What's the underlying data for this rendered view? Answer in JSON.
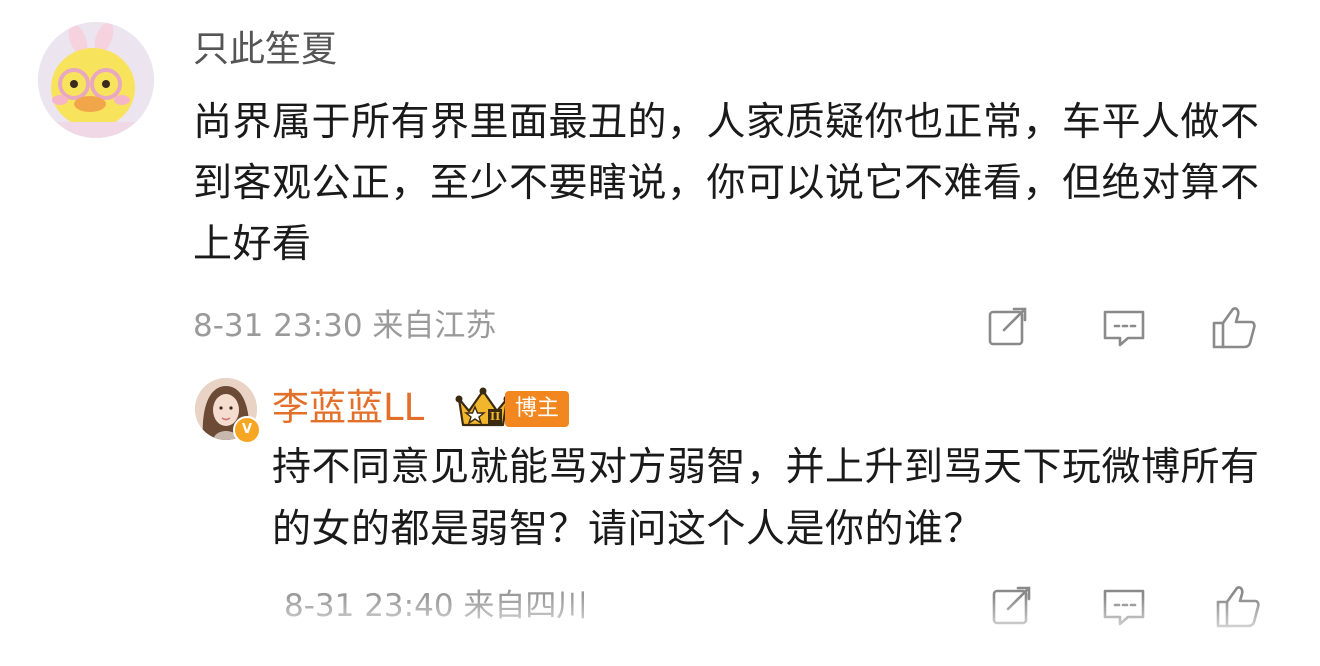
{
  "main_comment": {
    "username": "只此笙夏",
    "avatar": "duck-avatar-icon",
    "text": "尚界属于所有界里面最丑的，人家质疑你也正常，车平人做不到客观公正，至少不要瞎说，你可以说它不难看，但绝对算不上好看",
    "meta": "8-31 23:30 来自江苏",
    "actions": [
      "share-icon",
      "comment-icon",
      "like-icon"
    ]
  },
  "reply": {
    "username": "李蓝蓝LL",
    "avatar": "woman-avatar-icon",
    "verified_mark": "V",
    "crown_level": "II",
    "badge": "博主",
    "text": "持不同意见就能骂对方弱智，并上升到骂天下玩微博所有的女的都是弱智？请问这个人是你的谁？",
    "meta": "8-31 23:40 来自四川",
    "actions": [
      "share-icon",
      "comment-icon",
      "like-icon"
    ]
  },
  "colors": {
    "username_reply": "#e2702a",
    "badge_bg": "#f3871f",
    "meta_text": "#9a9a9a",
    "icon_stroke": "#8a8a8a"
  }
}
